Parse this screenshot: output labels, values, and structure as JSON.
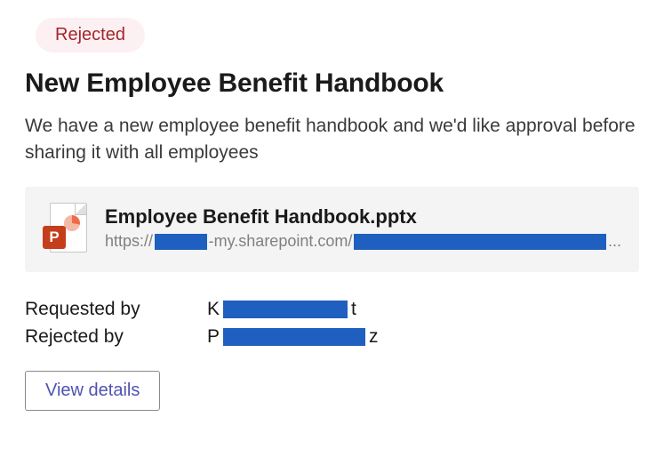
{
  "status": {
    "label": "Rejected"
  },
  "title": "New Employee Benefit Handbook",
  "description": "We have a new employee benefit handbook and we'd like approval before sharing it with all employees",
  "attachment": {
    "name": "Employee Benefit Handbook.pptx",
    "url_prefix": "https://",
    "url_mid": "-my.sharepoint.com/",
    "url_suffix": "...",
    "icon_letter": "P"
  },
  "meta": {
    "requested_by_label": "Requested by",
    "rejected_by_label": "Rejected by",
    "requested_by_first": "K",
    "requested_by_last": "t",
    "rejected_by_first": "P",
    "rejected_by_last": "z"
  },
  "actions": {
    "view_details": "View details"
  }
}
